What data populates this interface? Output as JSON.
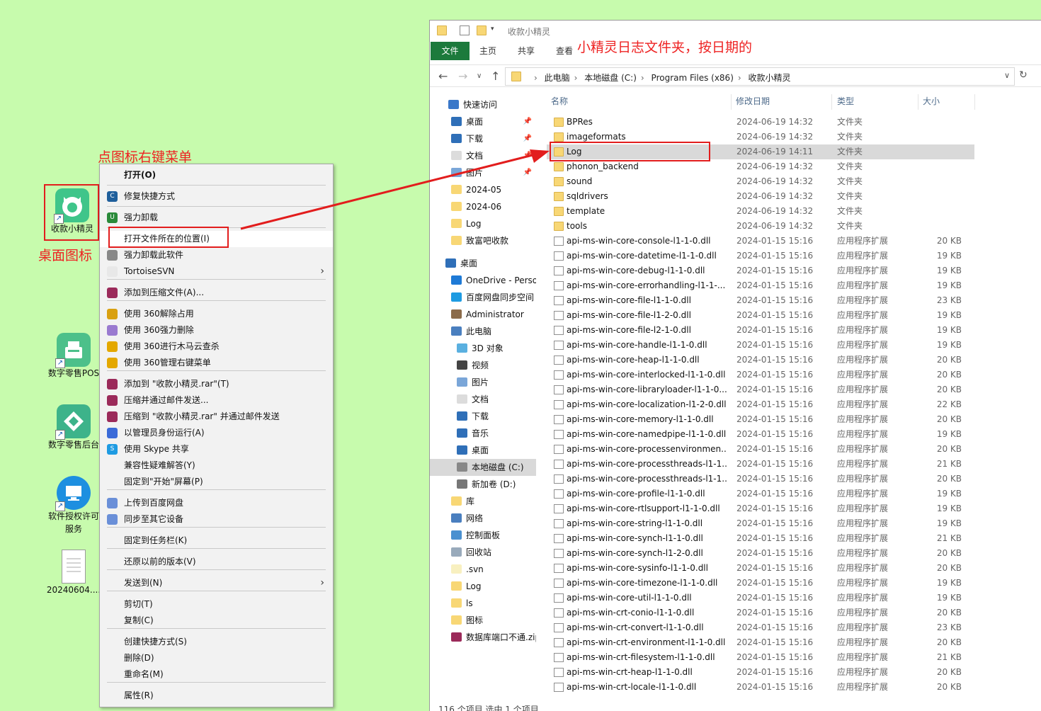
{
  "desktop": {
    "icons": [
      {
        "label": "收款小精灵",
        "color": "#3fc58a"
      },
      {
        "label": "数字零售POS",
        "color": "#4cc08a"
      },
      {
        "label": "数字零售后台",
        "color": "#3db38a"
      },
      {
        "label": "软件授权许可",
        "label2": "服务",
        "color": "#1d8fe0"
      },
      {
        "label": "20240604...."
      }
    ]
  },
  "annotations": {
    "menu_note": "点图标右键菜单",
    "icon_note": "桌面图标",
    "folder_note": "小精灵日志文件夹，按日期的"
  },
  "context_menu": {
    "items": [
      "打开(O)",
      "修复快捷方式",
      "强力卸载",
      "打开文件所在的位置(I)",
      "强力卸载此软件",
      "TortoiseSVN",
      "添加到压缩文件(A)...",
      "使用 360解除占用",
      "使用 360强力删除",
      "使用 360进行木马云查杀",
      "使用 360管理右键菜单",
      "添加到 \"收款小精灵.rar\"(T)",
      "压缩并通过邮件发送...",
      "压缩到 \"收款小精灵.rar\" 并通过邮件发送",
      "以管理员身份运行(A)",
      "使用 Skype 共享",
      "兼容性疑难解答(Y)",
      "固定到\"开始\"屏幕(P)",
      "上传到百度网盘",
      "同步至其它设备",
      "固定到任务栏(K)",
      "还原以前的版本(V)",
      "发送到(N)",
      "剪切(T)",
      "复制(C)",
      "创建快捷方式(S)",
      "删除(D)",
      "重命名(M)",
      "属性(R)"
    ]
  },
  "explorer": {
    "title": "收款小精灵",
    "tabs": [
      "文件",
      "主页",
      "共享",
      "查看"
    ],
    "breadcrumbs": [
      "此电脑",
      "本地磁盘 (C:)",
      "Program Files (x86)",
      "收款小精灵"
    ],
    "columns": [
      "名称",
      "修改日期",
      "类型",
      "大小"
    ],
    "nav": [
      "快速访问",
      "桌面",
      "下载",
      "文档",
      "图片",
      "2024-05",
      "2024-06",
      "Log",
      "致富吧收款",
      "桌面",
      "OneDrive - Personal",
      "百度网盘同步空间",
      "Administrator",
      "此电脑",
      "3D 对象",
      "视频",
      "图片",
      "文档",
      "下载",
      "音乐",
      "桌面",
      "本地磁盘 (C:)",
      "新加卷 (D:)",
      "库",
      "网络",
      "控制面板",
      "回收站",
      ".svn",
      "Log",
      "ls",
      "图标",
      "数据库端口不通.zip"
    ],
    "files": [
      {
        "name": "BPRes",
        "date": "2024-06-19 14:32",
        "type": "文件夹",
        "size": "",
        "kind": "folder"
      },
      {
        "name": "imageformats",
        "date": "2024-06-19 14:32",
        "type": "文件夹",
        "size": "",
        "kind": "folder"
      },
      {
        "name": "Log",
        "date": "2024-06-19 14:11",
        "type": "文件夹",
        "size": "",
        "kind": "folder"
      },
      {
        "name": "phonon_backend",
        "date": "2024-06-19 14:32",
        "type": "文件夹",
        "size": "",
        "kind": "folder"
      },
      {
        "name": "sound",
        "date": "2024-06-19 14:32",
        "type": "文件夹",
        "size": "",
        "kind": "folder"
      },
      {
        "name": "sqldrivers",
        "date": "2024-06-19 14:32",
        "type": "文件夹",
        "size": "",
        "kind": "folder"
      },
      {
        "name": "template",
        "date": "2024-06-19 14:32",
        "type": "文件夹",
        "size": "",
        "kind": "folder"
      },
      {
        "name": "tools",
        "date": "2024-06-19 14:32",
        "type": "文件夹",
        "size": "",
        "kind": "folder"
      },
      {
        "name": "api-ms-win-core-console-l1-1-0.dll",
        "date": "2024-01-15 15:16",
        "type": "应用程序扩展",
        "size": "20 KB",
        "kind": "dll"
      },
      {
        "name": "api-ms-win-core-datetime-l1-1-0.dll",
        "date": "2024-01-15 15:16",
        "type": "应用程序扩展",
        "size": "19 KB",
        "kind": "dll"
      },
      {
        "name": "api-ms-win-core-debug-l1-1-0.dll",
        "date": "2024-01-15 15:16",
        "type": "应用程序扩展",
        "size": "19 KB",
        "kind": "dll"
      },
      {
        "name": "api-ms-win-core-errorhandling-l1-1-...",
        "date": "2024-01-15 15:16",
        "type": "应用程序扩展",
        "size": "19 KB",
        "kind": "dll"
      },
      {
        "name": "api-ms-win-core-file-l1-1-0.dll",
        "date": "2024-01-15 15:16",
        "type": "应用程序扩展",
        "size": "23 KB",
        "kind": "dll"
      },
      {
        "name": "api-ms-win-core-file-l1-2-0.dll",
        "date": "2024-01-15 15:16",
        "type": "应用程序扩展",
        "size": "19 KB",
        "kind": "dll"
      },
      {
        "name": "api-ms-win-core-file-l2-1-0.dll",
        "date": "2024-01-15 15:16",
        "type": "应用程序扩展",
        "size": "19 KB",
        "kind": "dll"
      },
      {
        "name": "api-ms-win-core-handle-l1-1-0.dll",
        "date": "2024-01-15 15:16",
        "type": "应用程序扩展",
        "size": "19 KB",
        "kind": "dll"
      },
      {
        "name": "api-ms-win-core-heap-l1-1-0.dll",
        "date": "2024-01-15 15:16",
        "type": "应用程序扩展",
        "size": "20 KB",
        "kind": "dll"
      },
      {
        "name": "api-ms-win-core-interlocked-l1-1-0.dll",
        "date": "2024-01-15 15:16",
        "type": "应用程序扩展",
        "size": "20 KB",
        "kind": "dll"
      },
      {
        "name": "api-ms-win-core-libraryloader-l1-1-0....",
        "date": "2024-01-15 15:16",
        "type": "应用程序扩展",
        "size": "20 KB",
        "kind": "dll"
      },
      {
        "name": "api-ms-win-core-localization-l1-2-0.dll",
        "date": "2024-01-15 15:16",
        "type": "应用程序扩展",
        "size": "22 KB",
        "kind": "dll"
      },
      {
        "name": "api-ms-win-core-memory-l1-1-0.dll",
        "date": "2024-01-15 15:16",
        "type": "应用程序扩展",
        "size": "20 KB",
        "kind": "dll"
      },
      {
        "name": "api-ms-win-core-namedpipe-l1-1-0.dll",
        "date": "2024-01-15 15:16",
        "type": "应用程序扩展",
        "size": "19 KB",
        "kind": "dll"
      },
      {
        "name": "api-ms-win-core-processenvironmen...",
        "date": "2024-01-15 15:16",
        "type": "应用程序扩展",
        "size": "20 KB",
        "kind": "dll"
      },
      {
        "name": "api-ms-win-core-processthreads-l1-1...",
        "date": "2024-01-15 15:16",
        "type": "应用程序扩展",
        "size": "21 KB",
        "kind": "dll"
      },
      {
        "name": "api-ms-win-core-processthreads-l1-1...",
        "date": "2024-01-15 15:16",
        "type": "应用程序扩展",
        "size": "20 KB",
        "kind": "dll"
      },
      {
        "name": "api-ms-win-core-profile-l1-1-0.dll",
        "date": "2024-01-15 15:16",
        "type": "应用程序扩展",
        "size": "19 KB",
        "kind": "dll"
      },
      {
        "name": "api-ms-win-core-rtlsupport-l1-1-0.dll",
        "date": "2024-01-15 15:16",
        "type": "应用程序扩展",
        "size": "19 KB",
        "kind": "dll"
      },
      {
        "name": "api-ms-win-core-string-l1-1-0.dll",
        "date": "2024-01-15 15:16",
        "type": "应用程序扩展",
        "size": "19 KB",
        "kind": "dll"
      },
      {
        "name": "api-ms-win-core-synch-l1-1-0.dll",
        "date": "2024-01-15 15:16",
        "type": "应用程序扩展",
        "size": "21 KB",
        "kind": "dll"
      },
      {
        "name": "api-ms-win-core-synch-l1-2-0.dll",
        "date": "2024-01-15 15:16",
        "type": "应用程序扩展",
        "size": "20 KB",
        "kind": "dll"
      },
      {
        "name": "api-ms-win-core-sysinfo-l1-1-0.dll",
        "date": "2024-01-15 15:16",
        "type": "应用程序扩展",
        "size": "20 KB",
        "kind": "dll"
      },
      {
        "name": "api-ms-win-core-timezone-l1-1-0.dll",
        "date": "2024-01-15 15:16",
        "type": "应用程序扩展",
        "size": "19 KB",
        "kind": "dll"
      },
      {
        "name": "api-ms-win-core-util-l1-1-0.dll",
        "date": "2024-01-15 15:16",
        "type": "应用程序扩展",
        "size": "19 KB",
        "kind": "dll"
      },
      {
        "name": "api-ms-win-crt-conio-l1-1-0.dll",
        "date": "2024-01-15 15:16",
        "type": "应用程序扩展",
        "size": "20 KB",
        "kind": "dll"
      },
      {
        "name": "api-ms-win-crt-convert-l1-1-0.dll",
        "date": "2024-01-15 15:16",
        "type": "应用程序扩展",
        "size": "23 KB",
        "kind": "dll"
      },
      {
        "name": "api-ms-win-crt-environment-l1-1-0.dll",
        "date": "2024-01-15 15:16",
        "type": "应用程序扩展",
        "size": "20 KB",
        "kind": "dll"
      },
      {
        "name": "api-ms-win-crt-filesystem-l1-1-0.dll",
        "date": "2024-01-15 15:16",
        "type": "应用程序扩展",
        "size": "21 KB",
        "kind": "dll"
      },
      {
        "name": "api-ms-win-crt-heap-l1-1-0.dll",
        "date": "2024-01-15 15:16",
        "type": "应用程序扩展",
        "size": "20 KB",
        "kind": "dll"
      },
      {
        "name": "api-ms-win-crt-locale-l1-1-0.dll",
        "date": "2024-01-15 15:16",
        "type": "应用程序扩展",
        "size": "20 KB",
        "kind": "dll"
      }
    ],
    "status": "116 个项目    选中 1 个项目"
  }
}
